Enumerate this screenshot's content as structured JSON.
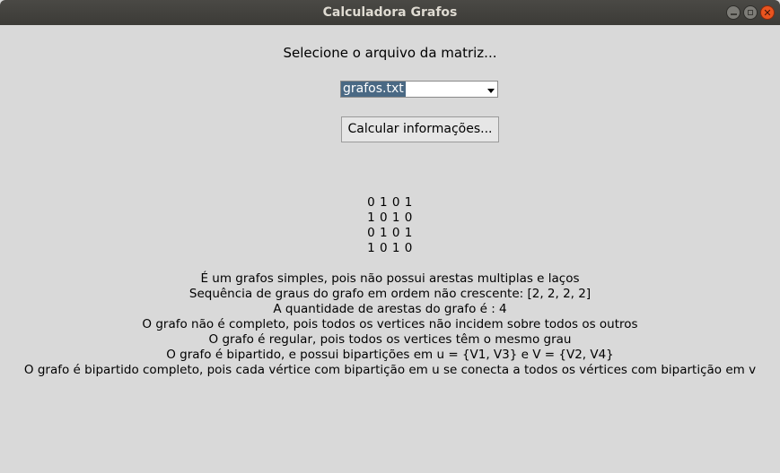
{
  "window": {
    "title": "Calculadora Grafos"
  },
  "prompt": {
    "label": "Selecione o arquivo da matriz..."
  },
  "file_select": {
    "value": "grafos.txt"
  },
  "calculate_button": {
    "label": "Calcular informações..."
  },
  "matrix": {
    "rows": [
      "0 1 0 1",
      "1 0 1 0",
      "0 1 0 1",
      "1 0 1 0"
    ]
  },
  "results": {
    "lines": [
      "É um grafos simples, pois não possui arestas multiplas e laços",
      "Sequência de graus do grafo em ordem não crescente: [2, 2, 2, 2]",
      "A quantidade de arestas do grafo é : 4",
      "O grafo não é completo, pois todos os vertices não incidem sobre todos os outros",
      "O grafo é regular, pois todos os vertices têm o mesmo grau",
      "O grafo é bipartido, e possui bipartições em u = {V1, V3} e V = {V2, V4}",
      "O grafo é bipartido completo, pois cada vértice com bipartição em u se conecta a todos os vértices com bipartição em v"
    ]
  }
}
